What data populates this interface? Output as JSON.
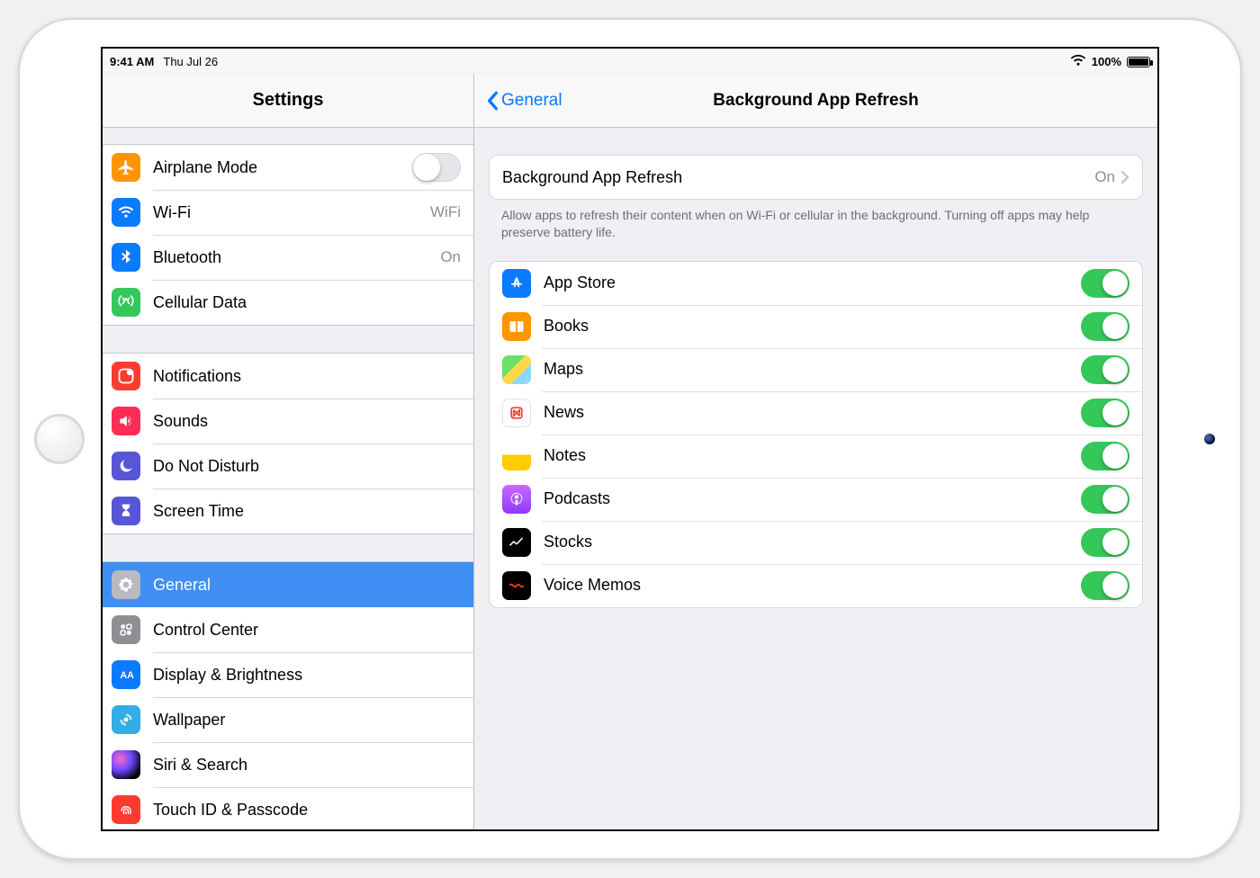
{
  "status": {
    "time": "9:41 AM",
    "date": "Thu Jul 26",
    "battery_pct": "100%"
  },
  "sidebar": {
    "title": "Settings",
    "groups": [
      [
        {
          "id": "airplane",
          "label": "Airplane Mode",
          "accessory": "toggle-off"
        },
        {
          "id": "wifi",
          "label": "Wi-Fi",
          "value": "WiFi"
        },
        {
          "id": "bluetooth",
          "label": "Bluetooth",
          "value": "On"
        },
        {
          "id": "cellular",
          "label": "Cellular Data"
        }
      ],
      [
        {
          "id": "notifications",
          "label": "Notifications"
        },
        {
          "id": "sounds",
          "label": "Sounds"
        },
        {
          "id": "dnd",
          "label": "Do Not Disturb"
        },
        {
          "id": "screentime",
          "label": "Screen Time"
        }
      ],
      [
        {
          "id": "general",
          "label": "General",
          "selected": true
        },
        {
          "id": "control",
          "label": "Control Center"
        },
        {
          "id": "display",
          "label": "Display & Brightness"
        },
        {
          "id": "wallpaper",
          "label": "Wallpaper"
        },
        {
          "id": "siri",
          "label": "Siri & Search"
        },
        {
          "id": "touchid",
          "label": "Touch ID & Passcode"
        }
      ]
    ]
  },
  "detail": {
    "back_label": "General",
    "title": "Background App Refresh",
    "master": {
      "label": "Background App Refresh",
      "value": "On"
    },
    "footer": "Allow apps to refresh their content when on Wi-Fi or cellular in the background. Turning off apps may help preserve battery life.",
    "apps": [
      {
        "id": "appstore",
        "label": "App Store",
        "on": true
      },
      {
        "id": "books",
        "label": "Books",
        "on": true
      },
      {
        "id": "maps",
        "label": "Maps",
        "on": true
      },
      {
        "id": "news",
        "label": "News",
        "on": true
      },
      {
        "id": "notes",
        "label": "Notes",
        "on": true
      },
      {
        "id": "podcasts",
        "label": "Podcasts",
        "on": true
      },
      {
        "id": "stocks",
        "label": "Stocks",
        "on": true
      },
      {
        "id": "voicememos",
        "label": "Voice Memos",
        "on": true
      }
    ]
  }
}
